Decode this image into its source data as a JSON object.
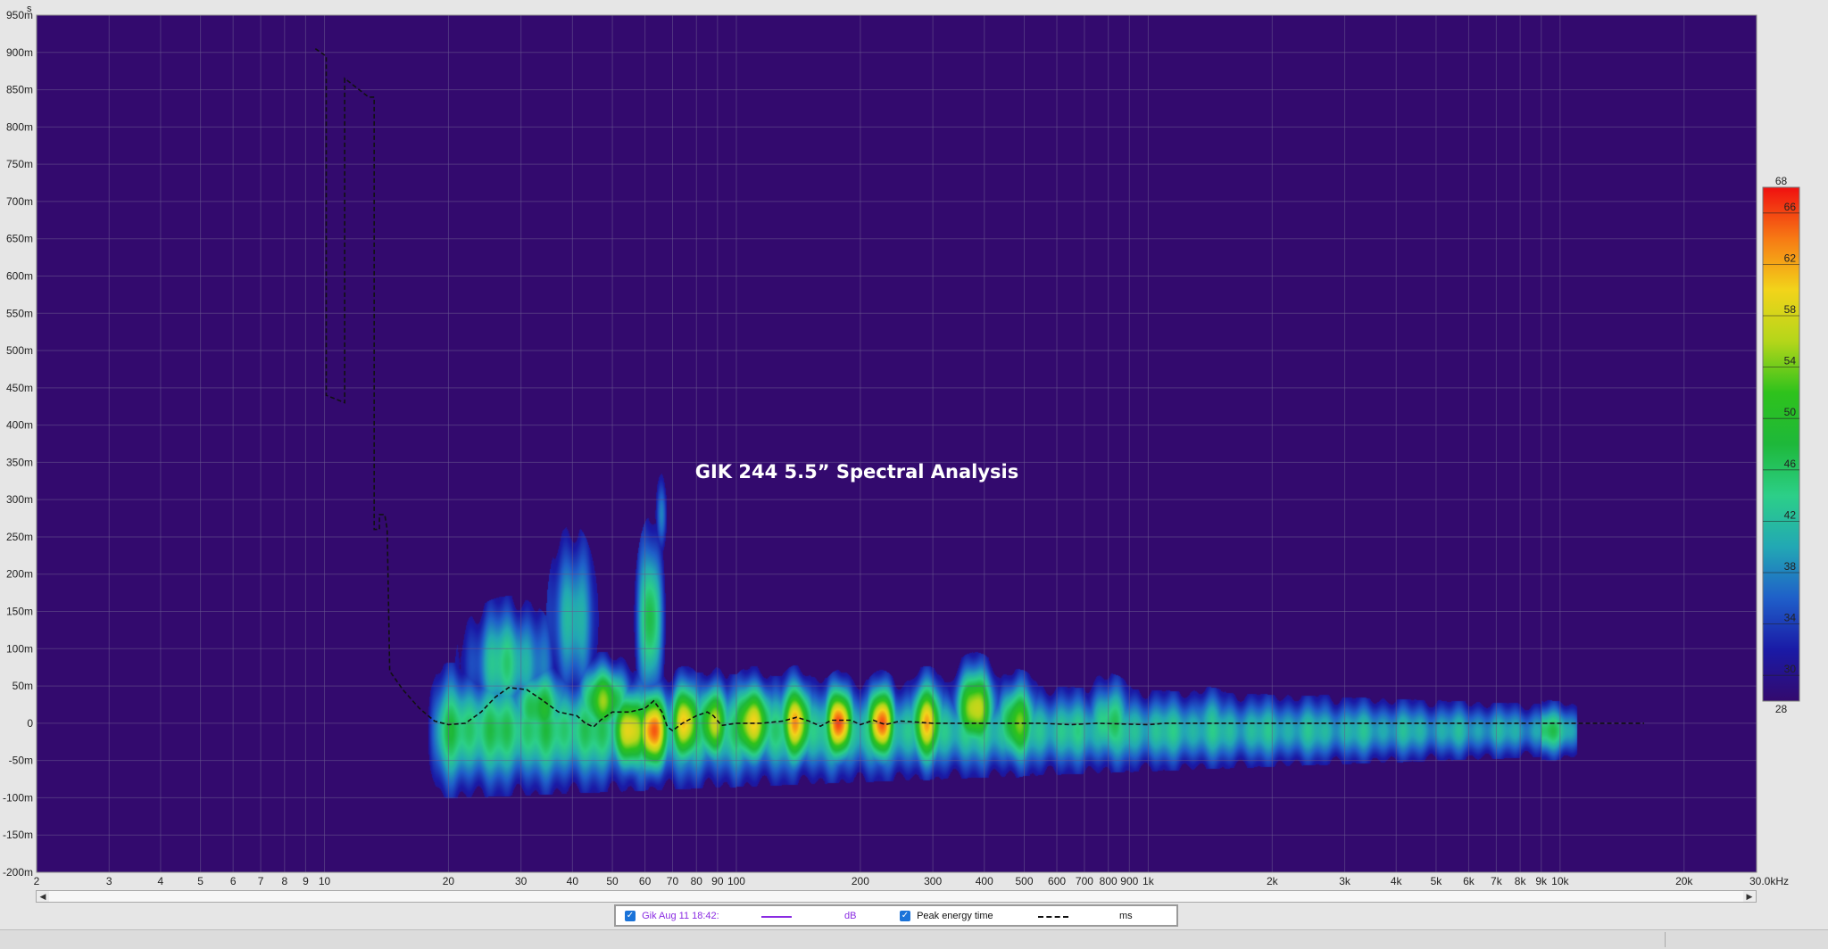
{
  "chart_data": {
    "type": "heatmap",
    "title": "GIK 244 5.5” Spectral Analysis",
    "xlabel": "kHz",
    "ylabel": "s",
    "x_scale": "log",
    "xlim": [
      2,
      30000
    ],
    "ylim": [
      -0.2,
      0.95
    ],
    "x_ticks": [
      {
        "v": 2,
        "label": "2"
      },
      {
        "v": 3,
        "label": "3"
      },
      {
        "v": 4,
        "label": "4"
      },
      {
        "v": 5,
        "label": "5"
      },
      {
        "v": 6,
        "label": "6"
      },
      {
        "v": 7,
        "label": "7"
      },
      {
        "v": 8,
        "label": "8"
      },
      {
        "v": 9,
        "label": "9"
      },
      {
        "v": 10,
        "label": "10"
      },
      {
        "v": 20,
        "label": "20"
      },
      {
        "v": 30,
        "label": "30"
      },
      {
        "v": 40,
        "label": "40"
      },
      {
        "v": 50,
        "label": "50"
      },
      {
        "v": 60,
        "label": "60"
      },
      {
        "v": 70,
        "label": "70"
      },
      {
        "v": 80,
        "label": "80"
      },
      {
        "v": 90,
        "label": "90"
      },
      {
        "v": 100,
        "label": "100"
      },
      {
        "v": 200,
        "label": "200"
      },
      {
        "v": 300,
        "label": "300"
      },
      {
        "v": 400,
        "label": "400"
      },
      {
        "v": 500,
        "label": "500"
      },
      {
        "v": 600,
        "label": "600"
      },
      {
        "v": 700,
        "label": "700"
      },
      {
        "v": 800,
        "label": "800"
      },
      {
        "v": 900,
        "label": "900"
      },
      {
        "v": 1000,
        "label": "1k"
      },
      {
        "v": 2000,
        "label": "2k"
      },
      {
        "v": 3000,
        "label": "3k"
      },
      {
        "v": 4000,
        "label": "4k"
      },
      {
        "v": 5000,
        "label": "5k"
      },
      {
        "v": 6000,
        "label": "6k"
      },
      {
        "v": 7000,
        "label": "7k"
      },
      {
        "v": 8000,
        "label": "8k"
      },
      {
        "v": 9000,
        "label": "9k"
      },
      {
        "v": 10000,
        "label": "10k"
      },
      {
        "v": 20000,
        "label": "20k"
      },
      {
        "v": 30000,
        "label": "30.0kHz"
      }
    ],
    "y_ticks": [
      {
        "v": 0.95,
        "label": "950m"
      },
      {
        "v": 0.9,
        "label": "900m"
      },
      {
        "v": 0.85,
        "label": "850m"
      },
      {
        "v": 0.8,
        "label": "800m"
      },
      {
        "v": 0.75,
        "label": "750m"
      },
      {
        "v": 0.7,
        "label": "700m"
      },
      {
        "v": 0.65,
        "label": "650m"
      },
      {
        "v": 0.6,
        "label": "600m"
      },
      {
        "v": 0.55,
        "label": "550m"
      },
      {
        "v": 0.5,
        "label": "500m"
      },
      {
        "v": 0.45,
        "label": "450m"
      },
      {
        "v": 0.4,
        "label": "400m"
      },
      {
        "v": 0.35,
        "label": "350m"
      },
      {
        "v": 0.3,
        "label": "300m"
      },
      {
        "v": 0.25,
        "label": "250m"
      },
      {
        "v": 0.2,
        "label": "200m"
      },
      {
        "v": 0.15,
        "label": "150m"
      },
      {
        "v": 0.1,
        "label": "100m"
      },
      {
        "v": 0.05,
        "label": "50m"
      },
      {
        "v": 0,
        "label": "0"
      },
      {
        "v": -0.05,
        "label": "-50m"
      },
      {
        "v": -0.1,
        "label": "-100m"
      },
      {
        "v": -0.15,
        "label": "-150m"
      },
      {
        "v": -0.2,
        "label": "-200m"
      }
    ],
    "colorbar": {
      "min": 28,
      "max": 68,
      "ticks": [
        28,
        30,
        34,
        38,
        42,
        46,
        50,
        54,
        58,
        62,
        66,
        68
      ],
      "stops": [
        {
          "v": 28,
          "color": "#330a6e"
        },
        {
          "v": 32,
          "color": "#1a1aa6"
        },
        {
          "v": 36,
          "color": "#1f5fc9"
        },
        {
          "v": 40,
          "color": "#22a8b4"
        },
        {
          "v": 44,
          "color": "#2ccf88"
        },
        {
          "v": 48,
          "color": "#1eb83a"
        },
        {
          "v": 52,
          "color": "#2ec21c"
        },
        {
          "v": 56,
          "color": "#b4d61a"
        },
        {
          "v": 60,
          "color": "#f2d41a"
        },
        {
          "v": 64,
          "color": "#f77a14"
        },
        {
          "v": 68,
          "color": "#f01010"
        }
      ]
    },
    "heat_sources": [
      {
        "f": 20,
        "f2": 9000,
        "t": -0.01,
        "sdt": 0.068,
        "level": 46
      },
      {
        "f": 28,
        "t": 0.08,
        "sdt": 0.07,
        "sdf": 0.1,
        "level": 44
      },
      {
        "f": 33,
        "t": 0.02,
        "sdt": 0.05,
        "sdf": 0.08,
        "level": 48
      },
      {
        "f": 40,
        "t": 0.14,
        "sdt": 0.1,
        "sdf": 0.05,
        "level": 43
      },
      {
        "f": 48,
        "t": 0.03,
        "sdt": 0.045,
        "sdf": 0.06,
        "level": 54
      },
      {
        "f": 55,
        "t": -0.01,
        "sdt": 0.05,
        "sdf": 0.05,
        "level": 60
      },
      {
        "f": 62,
        "t": 0.14,
        "sdt": 0.1,
        "sdf": 0.03,
        "level": 48
      },
      {
        "f": 63,
        "t": -0.01,
        "sdt": 0.05,
        "sdf": 0.04,
        "level": 66
      },
      {
        "f": 66,
        "t": 0.28,
        "sdt": 0.05,
        "sdf": 0.015,
        "level": 38
      },
      {
        "f": 75,
        "t": 0.0,
        "sdt": 0.05,
        "sdf": 0.04,
        "level": 60
      },
      {
        "f": 88,
        "t": 0.0,
        "sdt": 0.05,
        "sdf": 0.04,
        "level": 58
      },
      {
        "f": 110,
        "t": 0.0,
        "sdt": 0.05,
        "sdf": 0.05,
        "level": 60
      },
      {
        "f": 140,
        "t": 0.0,
        "sdt": 0.05,
        "sdf": 0.04,
        "level": 62
      },
      {
        "f": 178,
        "t": 0.0,
        "sdt": 0.045,
        "sdf": 0.035,
        "level": 66
      },
      {
        "f": 225,
        "t": 0.0,
        "sdt": 0.045,
        "sdf": 0.035,
        "level": 65
      },
      {
        "f": 290,
        "t": 0.0,
        "sdt": 0.05,
        "sdf": 0.04,
        "level": 60
      },
      {
        "f": 380,
        "t": 0.02,
        "sdt": 0.05,
        "sdf": 0.05,
        "level": 57
      },
      {
        "f": 480,
        "t": 0.0,
        "sdt": 0.05,
        "sdf": 0.05,
        "level": 53
      },
      {
        "f": 800,
        "t": 0.0,
        "sdt": 0.05,
        "sdf": 0.06,
        "level": 46
      },
      {
        "f": 1400,
        "t": 0.0,
        "sdt": 0.04,
        "sdf": 0.07,
        "level": 41
      },
      {
        "f": 2700,
        "t": 0.0,
        "sdt": 0.035,
        "sdf": 0.07,
        "level": 38
      },
      {
        "f": 4500,
        "t": 0.0,
        "sdt": 0.02,
        "sdf": 0.05,
        "level": 34
      }
    ],
    "series": [
      {
        "name": "Peak energy time",
        "style": "dashed",
        "color": "#111111",
        "points": [
          [
            9.5,
            0.905
          ],
          [
            10.1,
            0.895
          ],
          [
            10.1,
            0.44
          ],
          [
            11.2,
            0.43
          ],
          [
            11.2,
            0.865
          ],
          [
            12.8,
            0.84
          ],
          [
            13.2,
            0.84
          ],
          [
            13.2,
            0.26
          ],
          [
            13.6,
            0.26
          ],
          [
            13.6,
            0.28
          ],
          [
            14.0,
            0.28
          ],
          [
            14.2,
            0.26
          ],
          [
            14.4,
            0.07
          ],
          [
            15.5,
            0.045
          ],
          [
            17,
            0.02
          ],
          [
            18.5,
            0.003
          ],
          [
            20,
            -0.002
          ],
          [
            22,
            0.0
          ],
          [
            24,
            0.015
          ],
          [
            26,
            0.035
          ],
          [
            28,
            0.048
          ],
          [
            31,
            0.045
          ],
          [
            34,
            0.03
          ],
          [
            37,
            0.015
          ],
          [
            41,
            0.01
          ],
          [
            43,
            0.0
          ],
          [
            45,
            -0.005
          ],
          [
            47,
            0.005
          ],
          [
            50,
            0.015
          ],
          [
            55,
            0.015
          ],
          [
            60,
            0.02
          ],
          [
            63,
            0.03
          ],
          [
            66,
            0.015
          ],
          [
            68,
            -0.005
          ],
          [
            70,
            -0.01
          ],
          [
            74,
            0.0
          ],
          [
            80,
            0.01
          ],
          [
            85,
            0.015
          ],
          [
            88,
            0.01
          ],
          [
            92,
            -0.003
          ],
          [
            100,
            0.0
          ],
          [
            115,
            0.0
          ],
          [
            130,
            0.003
          ],
          [
            140,
            0.008
          ],
          [
            150,
            0.003
          ],
          [
            160,
            -0.004
          ],
          [
            170,
            0.004
          ],
          [
            190,
            0.004
          ],
          [
            200,
            -0.002
          ],
          [
            215,
            0.004
          ],
          [
            230,
            -0.002
          ],
          [
            250,
            0.003
          ],
          [
            300,
            0.0
          ],
          [
            400,
            0.0
          ],
          [
            550,
            0.0
          ],
          [
            650,
            -0.002
          ],
          [
            750,
            0.0
          ],
          [
            1000,
            -0.002
          ],
          [
            1100,
            0.0
          ],
          [
            2000,
            0.0
          ],
          [
            5000,
            0.0
          ],
          [
            10000,
            0.0
          ],
          [
            16000,
            0.0
          ]
        ]
      }
    ]
  },
  "legend": {
    "entries": [
      {
        "label": "Gik Aug 11 18:42:",
        "unit": "dB",
        "color": "#8a2be2",
        "checked": "✓"
      },
      {
        "label": "Peak energy time",
        "unit": "ms",
        "color": "#111111",
        "checked": "✓"
      }
    ]
  },
  "scrollbar": {
    "left_arrow": "◀",
    "right_arrow": "▶"
  }
}
